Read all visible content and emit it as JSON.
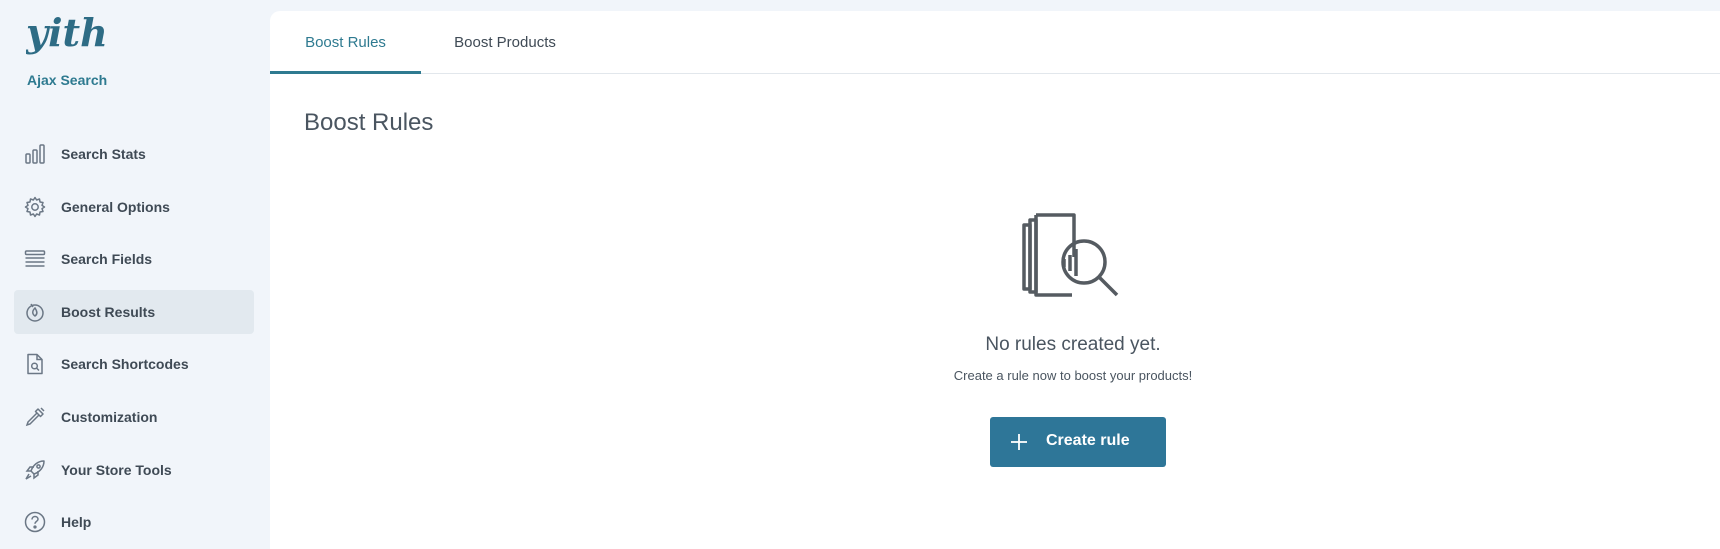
{
  "sidebar": {
    "logo_text": "yith",
    "plugin_name": "Ajax Search",
    "items": [
      {
        "label": "Search Stats",
        "icon": "bar-chart-icon",
        "active": false
      },
      {
        "label": "General Options",
        "icon": "gear-icon",
        "active": false
      },
      {
        "label": "Search Fields",
        "icon": "list-lines-icon",
        "active": false
      },
      {
        "label": "Boost Results",
        "icon": "boost-flame-icon",
        "active": true
      },
      {
        "label": "Search Shortcodes",
        "icon": "file-search-icon",
        "active": false
      },
      {
        "label": "Customization",
        "icon": "eyedropper-icon",
        "active": false
      },
      {
        "label": "Your Store Tools",
        "icon": "rocket-icon",
        "active": false
      },
      {
        "label": "Help",
        "icon": "question-circle-icon",
        "active": false
      }
    ]
  },
  "tabs": [
    {
      "label": "Boost Rules",
      "active": true
    },
    {
      "label": "Boost Products",
      "active": false
    }
  ],
  "main": {
    "title": "Boost Rules",
    "empty_state": {
      "icon": "documents-magnifier-icon",
      "title": "No rules created yet.",
      "subtitle": "Create a rule now to boost your products!",
      "button_label": "Create rule",
      "button_icon": "plus-icon"
    }
  },
  "colors": {
    "accent": "#2e7a90",
    "button": "#2e7698",
    "sidebar_bg": "#f1f5fa",
    "active_item_bg": "#e2e9ef",
    "text": "#3f4a55"
  }
}
